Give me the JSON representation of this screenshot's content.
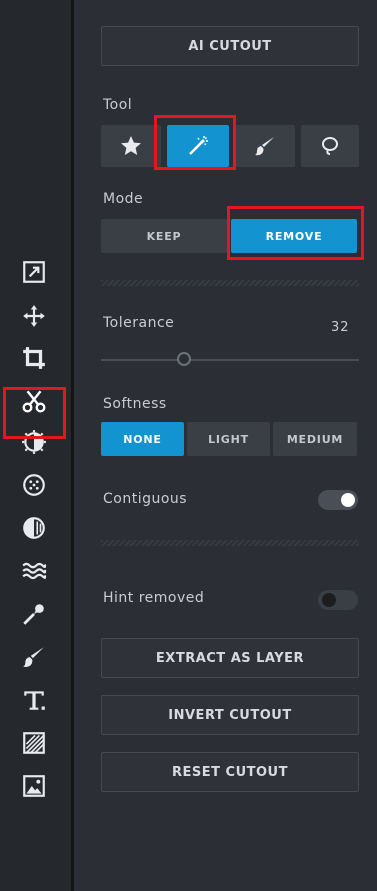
{
  "toolbar": {
    "icons": [
      "arrange-icon",
      "move-icon",
      "crop-icon",
      "cutout-icon",
      "adjust-icon",
      "effects-icon",
      "filter-icon",
      "liquify-icon",
      "retouch-icon",
      "draw-icon",
      "text-icon",
      "texture-icon",
      "image-icon"
    ],
    "active": "cutout-icon"
  },
  "panel": {
    "ai_cutout_label": "AI CUTOUT",
    "tool_label": "Tool",
    "mode_label": "Mode",
    "mode_keep": "KEEP",
    "mode_remove": "REMOVE",
    "tolerance_label": "Tolerance",
    "tolerance_value": "32",
    "tolerance_fraction": 0.32,
    "softness_label": "Softness",
    "softness_none": "NONE",
    "softness_light": "LIGHT",
    "softness_medium": "MEDIUM",
    "contiguous_label": "Contiguous",
    "contiguous_on": true,
    "hint_label": "Hint removed",
    "hint_on": false,
    "extract_label": "EXTRACT AS LAYER",
    "invert_label": "INVERT CUTOUT",
    "reset_label": "RESET CUTOUT"
  },
  "colors": {
    "accent": "#1493d1",
    "highlight": "#e5161f",
    "background": "#2b2e34"
  }
}
